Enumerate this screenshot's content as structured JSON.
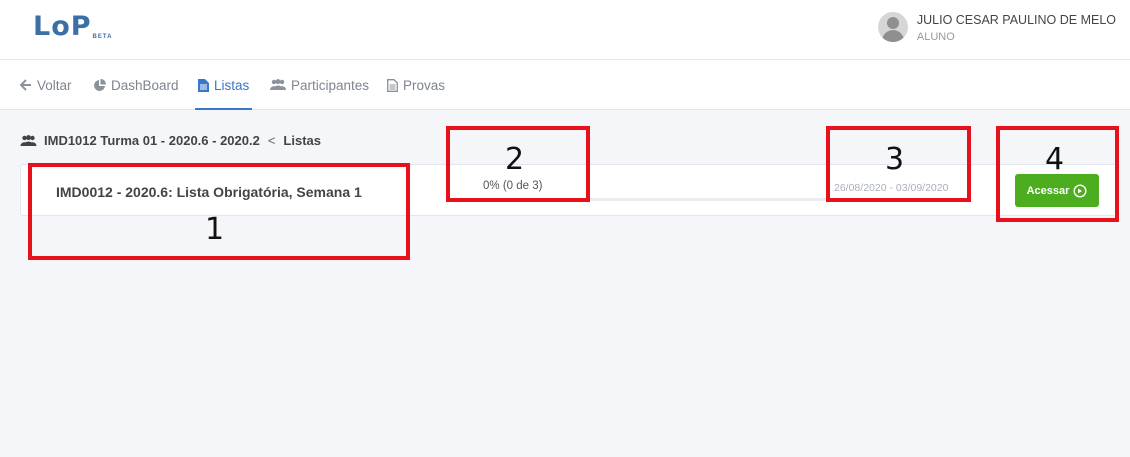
{
  "header": {
    "logo": "LoP",
    "logo_badge": "BETA",
    "user_name": "JULIO CESAR PAULINO DE MELO",
    "user_role": "ALUNO"
  },
  "nav": {
    "items": [
      {
        "label": "Voltar",
        "icon": "arrow-left-icon"
      },
      {
        "label": "DashBoard",
        "icon": "pie-chart-icon"
      },
      {
        "label": "Listas",
        "icon": "document-icon",
        "active": true
      },
      {
        "label": "Participantes",
        "icon": "users-icon"
      },
      {
        "label": "Provas",
        "icon": "document-outline-icon"
      }
    ]
  },
  "breadcrumb": {
    "class_name": "IMD1012 Turma 01 - 2020.6 - 2020.2",
    "separator": "<",
    "current": "Listas"
  },
  "list_card": {
    "title": "IMD0012 - 2020.6: Lista Obrigatória, Semana 1",
    "progress_text": "0% (0 de 3)",
    "progress_fraction": 0,
    "dates": "26/08/2020 - 03/09/2020",
    "access_label": "Acessar"
  },
  "annotations": [
    "1",
    "2",
    "3",
    "4"
  ],
  "colors": {
    "brand": "#3b6fa6",
    "active_nav": "#3a78c9",
    "button": "#4cae1f",
    "annotation": "#e8101a"
  }
}
